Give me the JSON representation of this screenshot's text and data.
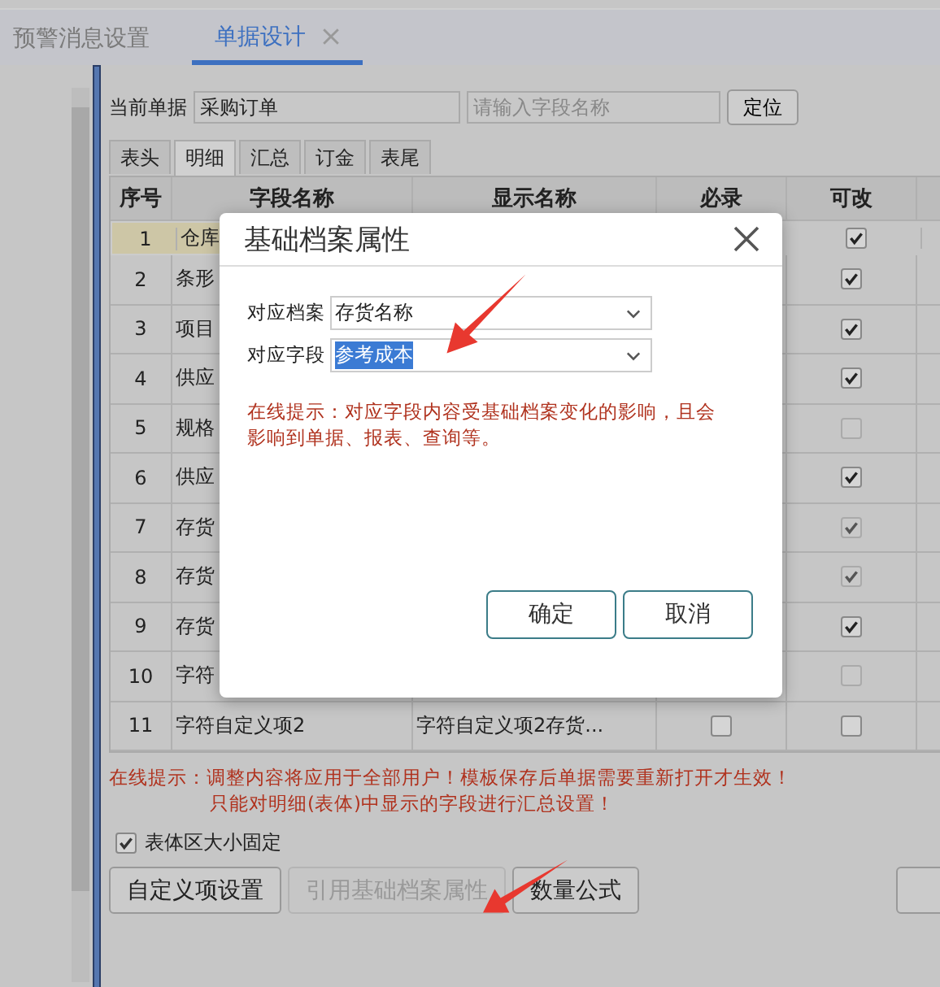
{
  "tabs": [
    {
      "label": "预警消息设置",
      "selected": false,
      "closable": false
    },
    {
      "label": "单据设计",
      "selected": true,
      "closable": true
    }
  ],
  "current_doc": {
    "label": "当前单据",
    "value": "采购订单"
  },
  "search": {
    "placeholder": "请输入字段名称"
  },
  "locate_button": "定位",
  "section_tabs": [
    {
      "label": "表头",
      "selected": false
    },
    {
      "label": "明细",
      "selected": true
    },
    {
      "label": "汇总",
      "selected": false
    },
    {
      "label": "订金",
      "selected": false
    },
    {
      "label": "表尾",
      "selected": false
    }
  ],
  "table": {
    "columns": [
      "序号",
      "字段名称",
      "显示名称",
      "必录",
      "可改"
    ],
    "rows": [
      {
        "no": "1",
        "field": "仓库",
        "display": "",
        "selected": true,
        "editable": {
          "checked": true,
          "disabled": false
        }
      },
      {
        "no": "2",
        "field": "条形",
        "display": "",
        "selected": false,
        "editable": {
          "checked": true,
          "disabled": false
        }
      },
      {
        "no": "3",
        "field": "项目",
        "display": "",
        "selected": false,
        "editable": {
          "checked": true,
          "disabled": false
        }
      },
      {
        "no": "4",
        "field": "供应",
        "display": "",
        "selected": false,
        "editable": {
          "checked": true,
          "disabled": false
        }
      },
      {
        "no": "5",
        "field": "规格",
        "display": "",
        "selected": false,
        "editable": {
          "checked": false,
          "disabled": true
        }
      },
      {
        "no": "6",
        "field": "供应",
        "display": "",
        "selected": false,
        "editable": {
          "checked": true,
          "disabled": false
        }
      },
      {
        "no": "7",
        "field": "存货",
        "display": "",
        "selected": false,
        "editable": {
          "checked": true,
          "disabled": true
        }
      },
      {
        "no": "8",
        "field": "存货",
        "display": "",
        "selected": false,
        "editable": {
          "checked": true,
          "disabled": true
        }
      },
      {
        "no": "9",
        "field": "存货",
        "display": "",
        "selected": false,
        "editable": {
          "checked": true,
          "disabled": false
        }
      },
      {
        "no": "10",
        "field": "字符",
        "display": "",
        "selected": false,
        "editable": {
          "checked": false,
          "disabled": true
        }
      },
      {
        "no": "11",
        "field": "字符自定义项2",
        "display": "字符自定义项2存货...",
        "selected": false,
        "required": {
          "checked": false,
          "disabled": false
        },
        "editable": {
          "checked": false,
          "disabled": false
        }
      }
    ]
  },
  "notice": {
    "lines": [
      "在线提示：调整内容将应用于全部用户！模板保存后单据需要重新打开才生效！",
      "只能对明细(表体)中显示的字段进行汇总设置！"
    ]
  },
  "fixed_size": {
    "label": "表体区大小固定",
    "checked": true
  },
  "buttons": [
    {
      "label": "自定义项设置",
      "disabled": false
    },
    {
      "label": "引用基础档案属性",
      "disabled": true
    },
    {
      "label": "数量公式",
      "disabled": false
    }
  ],
  "dialog": {
    "title": "基础档案属性",
    "fields": [
      {
        "label": "对应档案",
        "value": "存货名称",
        "highlighted": false
      },
      {
        "label": "对应字段",
        "value": "参考成本",
        "highlighted": true
      }
    ],
    "hint": "在线提示：对应字段内容受基础档案变化的影响，且会影响到单据、报表、查询等。",
    "buttons": [
      "确定",
      "取消"
    ]
  }
}
